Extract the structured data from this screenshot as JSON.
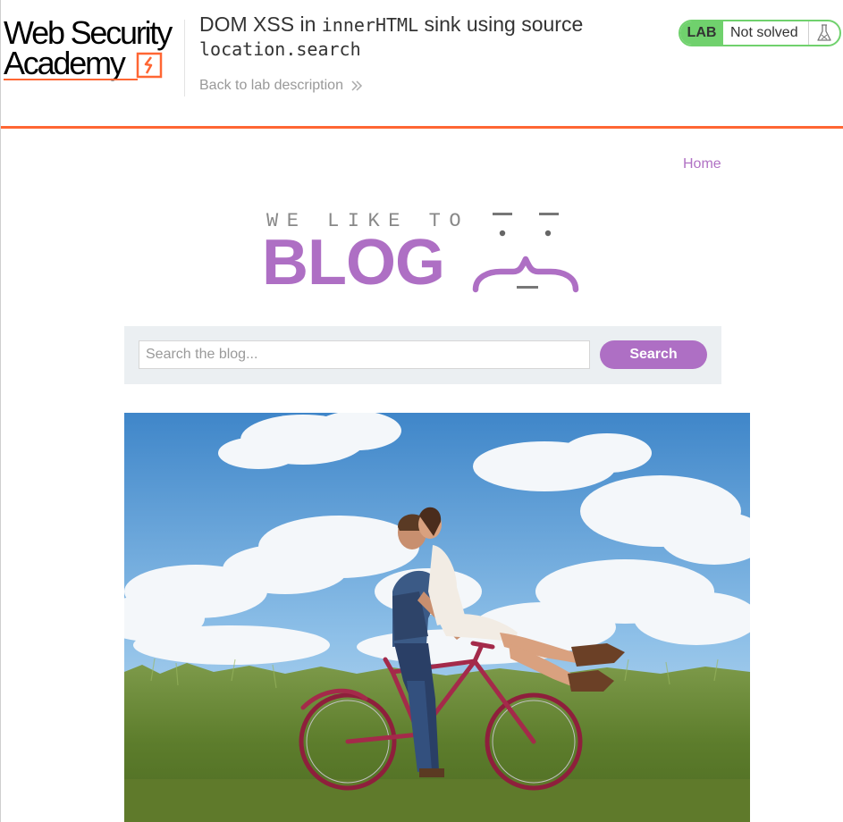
{
  "academy": {
    "logo_line1": "Web Security",
    "logo_line2": "Academy",
    "lab_title_prefix": "DOM XSS in ",
    "lab_title_code1": "innerHTML",
    "lab_title_middle": " sink using source",
    "lab_title_code2": "location.search",
    "back_link": "Back to lab description",
    "status_badge": "LAB",
    "status_text": "Not solved",
    "accent_color": "#ff6633",
    "status_color": "#70d16d"
  },
  "blog": {
    "nav_home": "Home",
    "logo_tagline": "WE LIKE TO",
    "logo_word": "BLOG",
    "brand_color": "#ae6fc4",
    "search": {
      "placeholder": "Search the blog...",
      "value": "",
      "button_label": "Search"
    },
    "post_image_icon": "couple-on-bicycle-photo"
  }
}
